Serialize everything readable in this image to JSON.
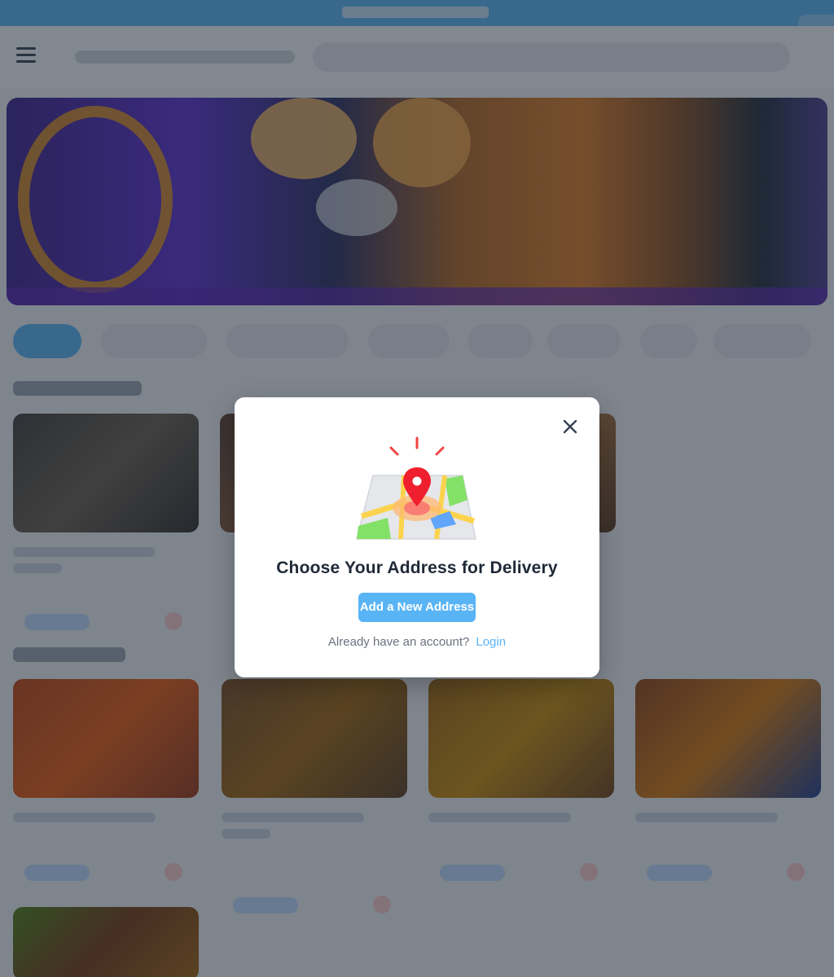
{
  "modal": {
    "title": "Choose Your Address for Delivery",
    "add_address_label": "Add a New Address",
    "account_prompt": "Already have an account?",
    "login_label": "Login",
    "close_icon": "close-icon",
    "illustration_icon": "map-pin-icon"
  },
  "colors": {
    "accent": "#59b4f5",
    "pin": "#ef1f2f",
    "overlay": "rgba(31,41,55,0.55)"
  }
}
